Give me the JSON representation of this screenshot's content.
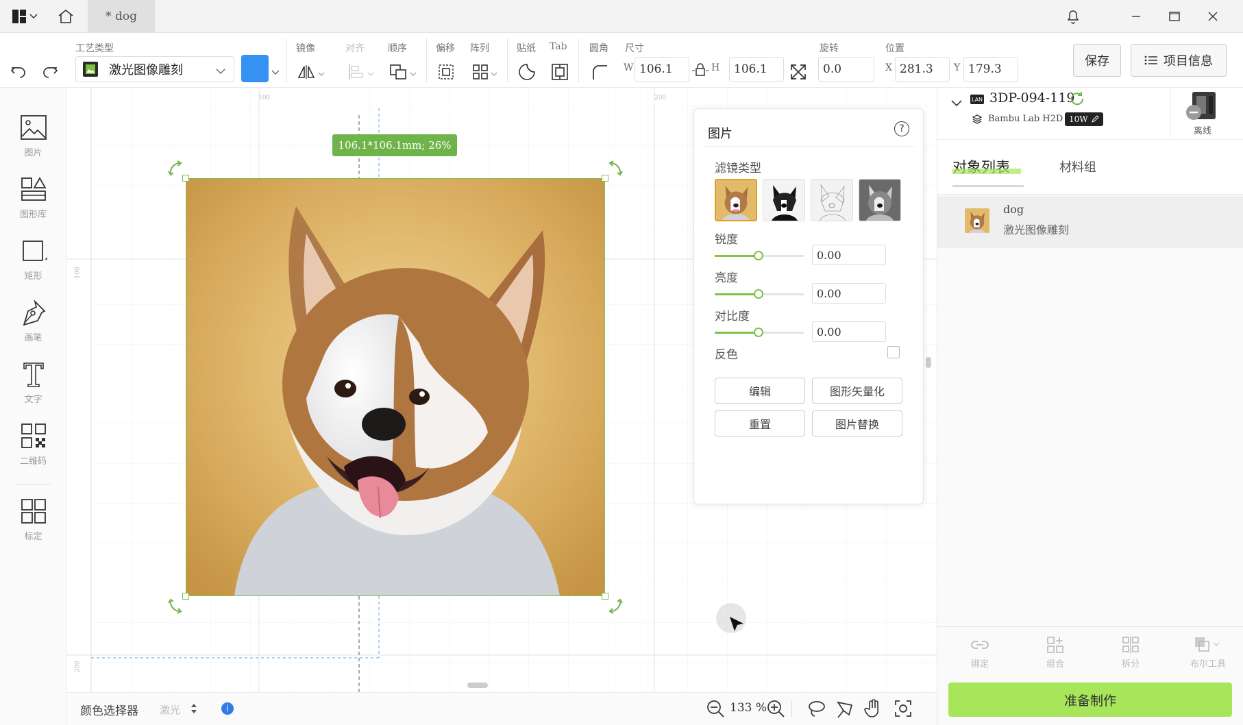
{
  "titlebar": {
    "tab_title": "* dog",
    "logo_icon": "app-logo-icon",
    "home_icon": "home-icon",
    "bell_icon": "bell-icon"
  },
  "toolbar": {
    "process_label": "工艺类型",
    "process_value": "激光图像雕刻",
    "mirror_label": "镜像",
    "align_label": "对齐",
    "order_label": "顺序",
    "offset_label": "偏移",
    "array_label": "阵列",
    "sticker_label": "贴纸",
    "tab_label": "Tab",
    "corner_label": "圆角",
    "size_label": "尺寸",
    "w_label": "W",
    "w_value": "106.1",
    "h_label": "H",
    "h_value": "106.1",
    "rotate_label": "旋转",
    "rotate_value": "0.0",
    "position_label": "位置",
    "x_label": "X",
    "x_value": "281.3",
    "y_label": "Y",
    "y_value": "179.3",
    "save_label": "保存",
    "project_info_label": "项目信息",
    "color_swatch": "#3592f2"
  },
  "sidebar": {
    "items": [
      {
        "label": "图片",
        "icon": "image-icon"
      },
      {
        "label": "图形库",
        "icon": "shape-library-icon"
      },
      {
        "label": "矩形",
        "icon": "rectangle-icon"
      },
      {
        "label": "画笔",
        "icon": "pen-icon"
      },
      {
        "label": "文字",
        "icon": "text-icon"
      },
      {
        "label": "二维码",
        "icon": "qrcode-icon"
      },
      {
        "label": "标定",
        "icon": "calibrate-icon"
      }
    ]
  },
  "canvas": {
    "size_badge": "106.1*106.1mm; 26%",
    "ruler_top_1": "100",
    "ruler_top_2": "200",
    "ruler_left_1": "100",
    "ruler_left_2": "200"
  },
  "image_panel": {
    "title": "图片",
    "filter_label": "滤镜类型",
    "sharpness_label": "锐度",
    "sharpness_value": "0.00",
    "brightness_label": "亮度",
    "brightness_value": "0.00",
    "contrast_label": "对比度",
    "contrast_value": "0.00",
    "invert_label": "反色",
    "edit_label": "编辑",
    "vectorize_label": "图形矢量化",
    "reset_label": "重置",
    "replace_label": "图片替换"
  },
  "device": {
    "name": "3DP-094-119",
    "model": "Bambu Lab H2D",
    "power_badge": "10W",
    "status": "离线",
    "lan_badge": "LAN"
  },
  "right_tabs": {
    "objects": "对象列表",
    "materials": "材料组"
  },
  "object_list": [
    {
      "name": "dog",
      "process": "激光图像雕刻"
    }
  ],
  "right_tools": {
    "bind": "绑定",
    "group": "组合",
    "split": "拆分",
    "boolean": "布尔工具"
  },
  "prepare_label": "准备制作",
  "bottom": {
    "color_picker_label": "颜色选择器",
    "laser_label": "激光",
    "zoom_value": "133 %"
  },
  "colors": {
    "accent_green": "#7fc04a",
    "prepare_green": "#a7e65a",
    "badge_green": "#6fb44a"
  }
}
